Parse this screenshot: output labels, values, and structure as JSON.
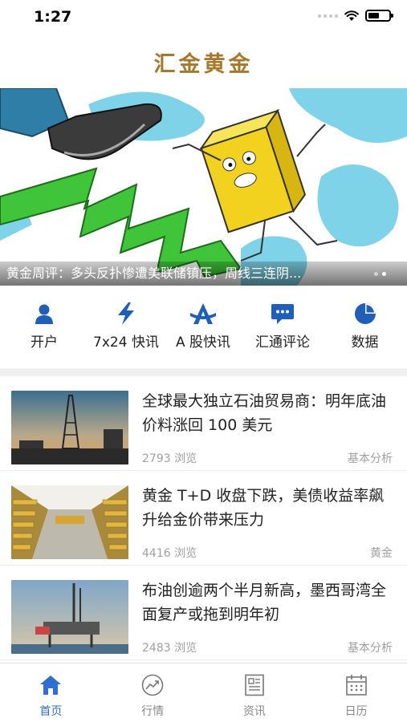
{
  "status": {
    "time": "1:27",
    "battery_level": 0.55
  },
  "app": {
    "title": "汇金黄金"
  },
  "banner": {
    "caption": "黄金周评：多头反扑惨遭美联储镇压，周线三连阴...",
    "dots": 2,
    "active_dot": 1
  },
  "quick_menu": [
    {
      "label": "开户",
      "icon": "person-icon"
    },
    {
      "label": "7x24 快讯",
      "icon": "lightning-icon"
    },
    {
      "label": "A 股快讯",
      "icon": "a-shares-icon"
    },
    {
      "label": "汇通评论",
      "icon": "chat-bubble-icon"
    },
    {
      "label": "数据",
      "icon": "pie-chart-icon"
    }
  ],
  "news": [
    {
      "title": "全球最大独立石油贸易商：明年底油价料涨回 100 美元",
      "views": "2793 浏览",
      "tag": "基本分析",
      "thumb": "oil-rig-sunset"
    },
    {
      "title": "黄金 T+D 收盘下跌，美债收益率飙升给金价带来压力",
      "views": "4416 浏览",
      "tag": "黄金",
      "thumb": "gold-vault"
    },
    {
      "title": "布油创逾两个半月新高，墨西哥湾全面复产或拖到明年初",
      "views": "2483 浏览",
      "tag": "基本分析",
      "thumb": "offshore-platform"
    }
  ],
  "tabs": [
    {
      "label": "首页",
      "icon": "home-icon",
      "active": true
    },
    {
      "label": "行情",
      "icon": "trend-icon",
      "active": false
    },
    {
      "label": "资讯",
      "icon": "news-icon",
      "active": false
    },
    {
      "label": "日历",
      "icon": "calendar-icon",
      "active": false
    }
  ],
  "colors": {
    "accent": "#2f6fd1",
    "title_gold": "#a8782a",
    "muted": "#a0a0a0"
  }
}
